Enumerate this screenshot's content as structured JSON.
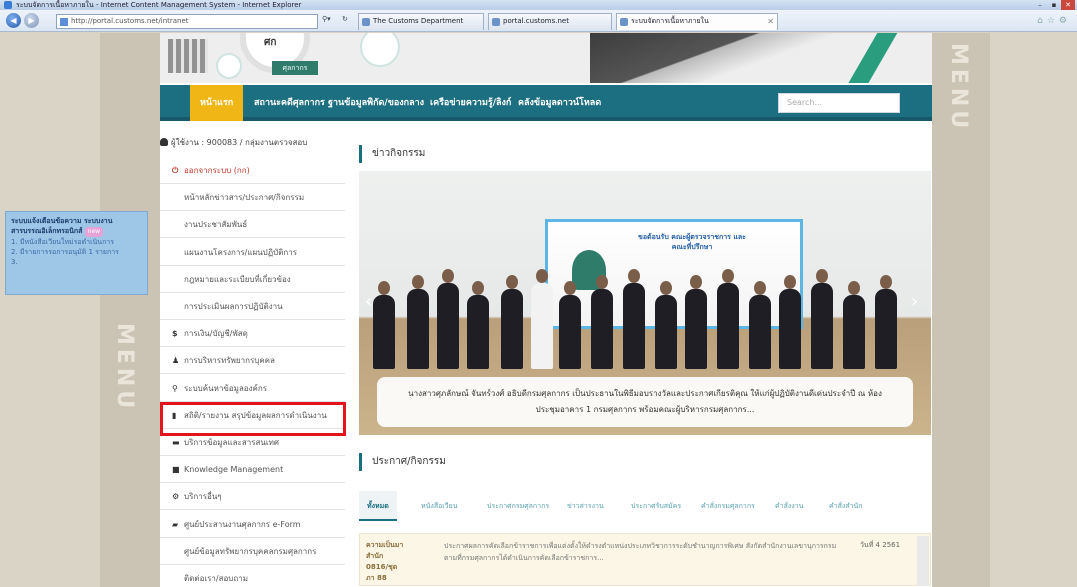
{
  "browser": {
    "title": "ระบบจัดการเนื้อหาภายใน - Internet Content Management System - Internet Explorer",
    "address": "http://portal.customs.net/intranet",
    "tabs": [
      "The Customs Department",
      "portal.customs.net",
      "ระบบจัดการเนื้อหาภายใน"
    ],
    "window_controls": [
      "–",
      "▪",
      "✕"
    ]
  },
  "site": {
    "logo_top": "ศก",
    "logo_sub": "ศุลกากร",
    "nav": [
      "หน้าแรก",
      "สถานะคดีศุลกากร",
      "ฐานข้อมูลพิกัด/ของกลาง",
      "เครือข่ายความรู้/ลิงก์",
      "คลังข้อมูลดาวน์โหลด"
    ],
    "search_placeholder": "Search...",
    "side_bg_text": "MENU"
  },
  "side_menu": {
    "user_line": "ผู้ใช้งาน : 900083 / กลุ่มงานตรวจสอบ",
    "items": [
      {
        "icon": "power-icon",
        "glyph": "⏻",
        "label": "ออกจากระบบ (กก)"
      },
      {
        "icon": "",
        "glyph": "",
        "label": "หน้าหลักข่าวสาร/ประกาศ/กิจกรรม"
      },
      {
        "icon": "",
        "glyph": "",
        "label": "งานประชาสัมพันธ์"
      },
      {
        "icon": "",
        "glyph": "",
        "label": "แผนงานโครงการ/แผนปฏิบัติการ"
      },
      {
        "icon": "",
        "glyph": "",
        "label": "กฎหมายและระเบียบที่เกี่ยวข้อง"
      },
      {
        "icon": "",
        "glyph": "",
        "label": "การประเมินผลการปฏิบัติงาน"
      },
      {
        "icon": "dollar-icon",
        "glyph": "$",
        "label": "การเงิน/บัญชี/พัสดุ"
      },
      {
        "icon": "user-icon",
        "glyph": "♟",
        "label": "การบริหารทรัพยากรบุคคล"
      },
      {
        "icon": "search-icon",
        "glyph": "⚲",
        "label": "ระบบค้นหาข้อมูลองค์กร"
      },
      {
        "icon": "bar-chart-icon",
        "glyph": "▮",
        "label": "สถิติ/รายงาน สรุปข้อมูลผลการดำเนินงาน"
      },
      {
        "icon": "book-icon",
        "glyph": "▬",
        "label": "บริการข้อมูลและสารสนเทศ"
      },
      {
        "icon": "book-icon",
        "glyph": "■",
        "label": "Knowledge Management"
      },
      {
        "icon": "gear-icon",
        "glyph": "⚙",
        "label": "บริการอื่นๆ"
      },
      {
        "icon": "folder-icon",
        "glyph": "▰",
        "label": "ศูนย์ประสานงานศุลกากร e-Form"
      },
      {
        "icon": "",
        "glyph": "",
        "label": "ศูนย์ข้อมูลทรัพยากรบุคคลกรมศุลกากร"
      },
      {
        "icon": "",
        "glyph": "",
        "label": "ติดต่อเรา/สอบถาม"
      }
    ]
  },
  "main": {
    "news_title": "ข่าวกิจกรรม",
    "screen_text": "ขอต้อนรับ คณะผู้ตรวจราชการ และคณะที่ปรึกษา",
    "caption": "นางสาวศุภลักษณ์ จันทร์วงศ์ อธิบดีกรมศุลกากร เป็นประธานในพิธีมอบรางวัลและประกาศเกียรติคุณ ให้แก่ผู้ปฏิบัติงานดีเด่นประจำปี ณ ห้องประชุมอาคาร 1 กรมศุลกากร พร้อมคณะผู้บริหารกรมศุลกากร...",
    "announce_title": "ประกาศ/กิจกรรม",
    "tabs": [
      "ทั้งหมด",
      "หนังสือเวียน",
      "ประกาศกรมศุลกากร",
      "ข่าวสารงาน",
      "ประกาศรับสมัคร",
      "คำสั่งกรมศุลกากร",
      "คำสั่งงาน",
      "คำสั่งสำนัก"
    ],
    "news_date": "ความเป็นมา สำนัก 0816/ชุดภา 88",
    "news_text": "ประกาศผลการคัดเลือกข้าราชการเพื่อแต่งตั้งให้ดำรงตำแหน่งประเภทวิชาการระดับชำนาญการพิเศษ สังกัดสำนักงานเลขานุการกรม ตามที่กรมศุลกากรได้ดำเนินการคัดเลือกข้าราชการ...",
    "news_right": "วันที่ 4 2561"
  },
  "widget": {
    "title": "ระบบแจ้งเตือนข้อความ ระบบงานสารบรรณอิเล็กทรอนิกส์",
    "badge": "new",
    "line1": "1. มีหนังสือเวียนใหม่รอดำเนินการ",
    "line2": "2. มีรายการรอการอนุมัติ 1 รายการ",
    "line3": "3."
  },
  "colors": {
    "nav_bg": "#1c6f80",
    "nav_active": "#f0b616",
    "highlight_border": "#e3141b"
  }
}
